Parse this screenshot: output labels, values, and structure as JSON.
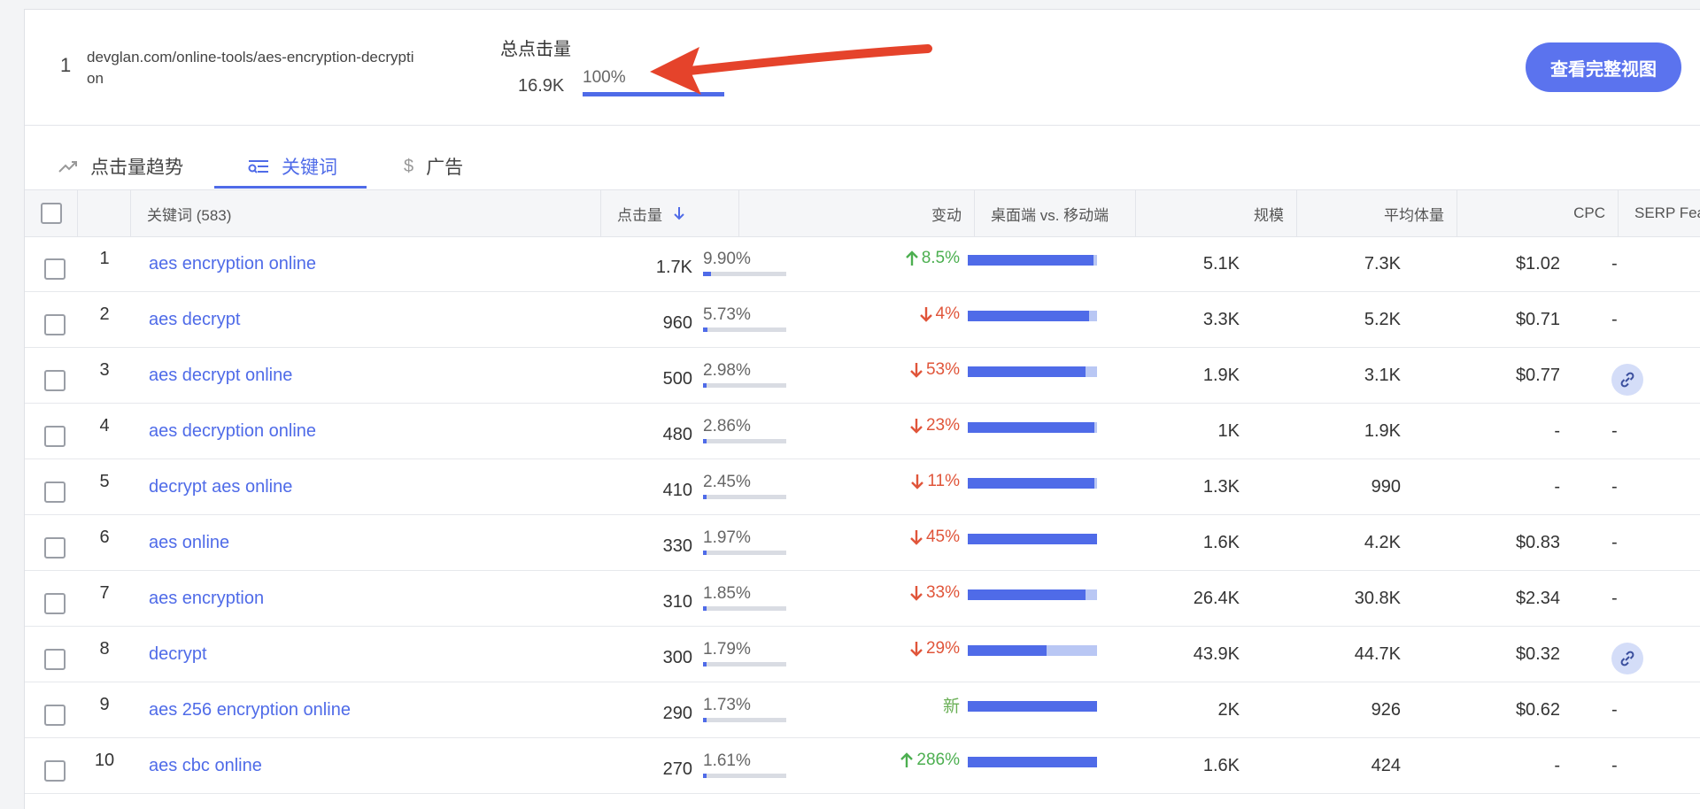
{
  "header": {
    "rank": "1",
    "url": "devglan.com/online-tools/aes-encryption-decryption",
    "total_clicks_title": "总点击量",
    "total_clicks_value": "16.9K",
    "total_clicks_share_label": "100%",
    "total_clicks_share": 1.0,
    "view_full_button": "查看完整视图"
  },
  "tabs": [
    {
      "label": "点击量趋势",
      "icon": "trend-icon",
      "active": false
    },
    {
      "label": "关键词",
      "icon": "keywords-icon",
      "active": true
    },
    {
      "label": "广告",
      "icon": "dollar-icon",
      "active": false
    }
  ],
  "columns": {
    "keyword": "关键词 (583)",
    "clicks": "点击量",
    "change": "变动",
    "desktop_mobile": "桌面端 vs. 移动端",
    "volume": "规模",
    "avg_volume": "平均体量",
    "cpc": "CPC",
    "serp": "SERP Features"
  },
  "rows": [
    {
      "num": "1",
      "keyword": "aes encryption online",
      "clicks": "1.7K",
      "share": "9.90%",
      "share_value": 0.099,
      "change": "8.5%",
      "dir": "up",
      "desktop_share": 0.97,
      "volume": "5.1K",
      "avg": "7.3K",
      "cpc": "$1.02",
      "serp": "-"
    },
    {
      "num": "2",
      "keyword": "aes decrypt",
      "clicks": "960",
      "share": "5.73%",
      "share_value": 0.0573,
      "change": "4%",
      "dir": "down",
      "desktop_share": 0.94,
      "volume": "3.3K",
      "avg": "5.2K",
      "cpc": "$0.71",
      "serp": "-"
    },
    {
      "num": "3",
      "keyword": "aes decrypt online",
      "clicks": "500",
      "share": "2.98%",
      "share_value": 0.0298,
      "change": "53%",
      "dir": "down",
      "desktop_share": 0.91,
      "volume": "1.9K",
      "avg": "3.1K",
      "cpc": "$0.77",
      "serp": "link-icon"
    },
    {
      "num": "4",
      "keyword": "aes decryption online",
      "clicks": "480",
      "share": "2.86%",
      "share_value": 0.0286,
      "change": "23%",
      "dir": "down",
      "desktop_share": 0.98,
      "volume": "1K",
      "avg": "1.9K",
      "cpc": "-",
      "serp": "-"
    },
    {
      "num": "5",
      "keyword": "decrypt aes online",
      "clicks": "410",
      "share": "2.45%",
      "share_value": 0.0245,
      "change": "11%",
      "dir": "down",
      "desktop_share": 0.98,
      "volume": "1.3K",
      "avg": "990",
      "cpc": "-",
      "serp": "-"
    },
    {
      "num": "6",
      "keyword": "aes online",
      "clicks": "330",
      "share": "1.97%",
      "share_value": 0.0197,
      "change": "45%",
      "dir": "down",
      "desktop_share": 1.0,
      "volume": "1.6K",
      "avg": "4.2K",
      "cpc": "$0.83",
      "serp": "-"
    },
    {
      "num": "7",
      "keyword": "aes encryption",
      "clicks": "310",
      "share": "1.85%",
      "share_value": 0.0185,
      "change": "33%",
      "dir": "down",
      "desktop_share": 0.91,
      "volume": "26.4K",
      "avg": "30.8K",
      "cpc": "$2.34",
      "serp": "-"
    },
    {
      "num": "8",
      "keyword": "decrypt",
      "clicks": "300",
      "share": "1.79%",
      "share_value": 0.0179,
      "change": "29%",
      "dir": "down",
      "desktop_share": 0.61,
      "volume": "43.9K",
      "avg": "44.7K",
      "cpc": "$0.32",
      "serp": "link-icon"
    },
    {
      "num": "9",
      "keyword": "aes 256 encryption online",
      "clicks": "290",
      "share": "1.73%",
      "share_value": 0.0173,
      "change": "新",
      "dir": "new",
      "desktop_share": 1.0,
      "volume": "2K",
      "avg": "926",
      "cpc": "$0.62",
      "serp": "-"
    },
    {
      "num": "10",
      "keyword": "aes cbc online",
      "clicks": "270",
      "share": "1.61%",
      "share_value": 0.0161,
      "change": "286%",
      "dir": "up",
      "desktop_share": 1.0,
      "volume": "1.6K",
      "avg": "424",
      "cpc": "-",
      "serp": "-"
    }
  ],
  "colors": {
    "accent": "#4f6be8",
    "up": "#4caf50",
    "down": "#e0553a",
    "annotation_arrow": "#e5432b"
  }
}
